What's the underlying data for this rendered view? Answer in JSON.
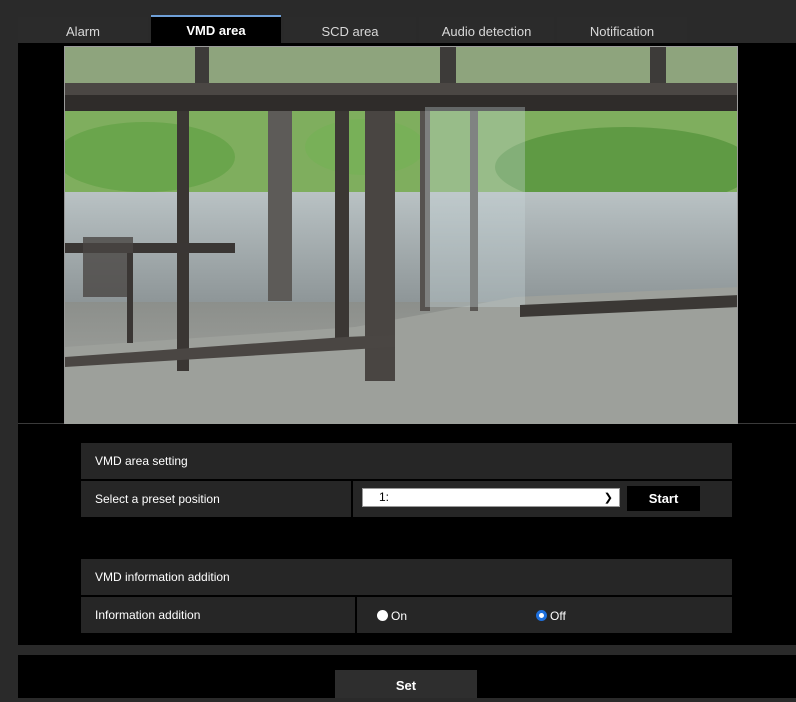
{
  "tabs": [
    {
      "label": "Alarm"
    },
    {
      "label": "VMD area"
    },
    {
      "label": "SCD area"
    },
    {
      "label": "Audio detection"
    },
    {
      "label": "Notification"
    }
  ],
  "active_tab": "VMD area",
  "vmd_area_setting": {
    "title": "VMD area setting",
    "preset_label": "Select a preset position",
    "preset_value": "1:",
    "start_label": "Start"
  },
  "vmd_info_addition": {
    "title": "VMD information addition",
    "info_label": "Information addition",
    "on_label": "On",
    "off_label": "Off",
    "selected": "Off"
  },
  "set_label": "Set",
  "colors": {
    "active_tab_accent": "#6fa0d8",
    "radio_selected": "#1e6fdc"
  }
}
